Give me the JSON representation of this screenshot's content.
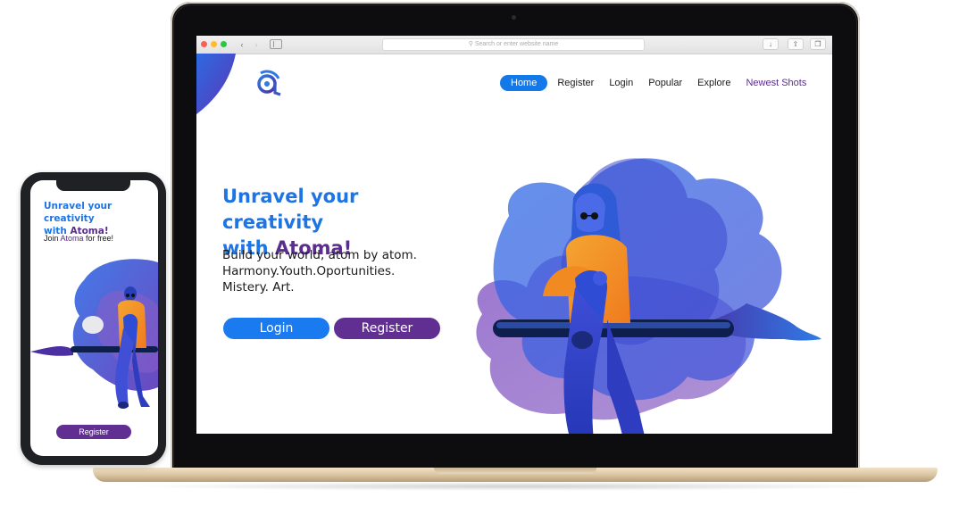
{
  "browser": {
    "address_placeholder": "Search or enter website name"
  },
  "desktop": {
    "nav": {
      "items": [
        {
          "label": "Home"
        },
        {
          "label": "Register"
        },
        {
          "label": "Login"
        },
        {
          "label": "Popular"
        },
        {
          "label": "Explore"
        },
        {
          "label": "Newest Shots"
        }
      ]
    },
    "hero": {
      "headline_line1": "Unravel your creativity",
      "headline_with": "with ",
      "headline_brand": "Atoma!",
      "subtext_line1": "Build your world, atom by atom.",
      "subtext_line2": "Harmony.Youth.Oportunities.",
      "subtext_line3": "Mistery. Art.",
      "login_label": "Login",
      "register_label": "Register"
    }
  },
  "mobile": {
    "title_line1": "Unravel your creativity",
    "title_with": "with ",
    "title_brand": "Atoma!",
    "sub_prefix": "Join ",
    "sub_brand": "Atoma",
    "sub_suffix": " for free!",
    "register_label": "Register"
  },
  "colors": {
    "primary_blue": "#1a7af0",
    "brand_purple": "#612f92"
  }
}
